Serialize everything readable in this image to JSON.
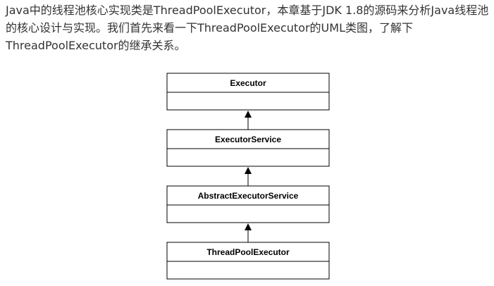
{
  "intro": {
    "lines": [
      "Java中的线程池核心实现类是ThreadPoolExecutor，本章基于JDK 1.8的源码来分析Java线程池",
      "的核心设计与实现。我们首先来看一下ThreadPoolExecutor的UML类图，了解下",
      "ThreadPoolExecutor的继承关系。"
    ]
  },
  "uml": {
    "classes": [
      {
        "name": "Executor"
      },
      {
        "name": "ExecutorService"
      },
      {
        "name": "AbstractExecutorService"
      },
      {
        "name": "ThreadPoolExecutor"
      }
    ],
    "colors": {
      "stroke": "#000000",
      "fill": "#ffffff"
    }
  }
}
